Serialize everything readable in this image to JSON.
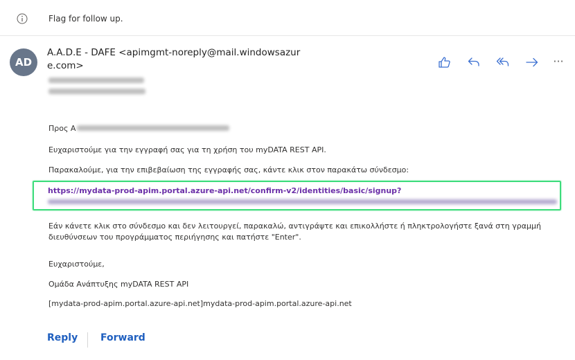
{
  "flag_bar": {
    "text": "Flag for follow up."
  },
  "sender": {
    "initials": "AD",
    "line1": "A.A.D.E - DAFE <apimgmt-noreply@mail.windowsazur",
    "line2": "e.com>"
  },
  "toolbar": {
    "like_icon": "thumbs-up-icon",
    "reply_icon": "reply-icon",
    "reply_all_icon": "reply-all-icon",
    "forward_icon": "forward-icon",
    "more_label": "···"
  },
  "body": {
    "greeting": "Προς Α",
    "line1": "Ευχαριστούμε για την εγγραφή σας για τη χρήση του myDATA REST API.",
    "line2": "Παρακαλούμε, για την επιβεβαίωση της εγγραφής σας, κάντε κλικ στον παρακάτω σύνδεσμο:",
    "link": "https://mydata-prod-apim.portal.azure-api.net/confirm-v2/identities/basic/signup?",
    "para": "Εάν κάνετε κλικ στο σύνδεσμο και δεν λειτουργεί, παρακαλώ, αντιγράψτε και επικολλήστε ή πληκτρολογήστε ξανά στη γραμμή διευθύνσεων του προγράμματος περιήγησης και πατήστε \"Enter\".",
    "thanks": "Ευχαριστούμε,",
    "team": "Ομάδα Ανάπτυξης myDATA REST API",
    "footer_link": "[mydata-prod-apim.portal.azure-api.net]mydata-prod-apim.portal.azure-api.net"
  },
  "footer": {
    "reply": "Reply",
    "forward": "Forward"
  },
  "colors": {
    "accent": "#1f5fbf",
    "link": "#6b2fa8",
    "highlight": "#3ddc7c",
    "avatar": "#68768a"
  }
}
